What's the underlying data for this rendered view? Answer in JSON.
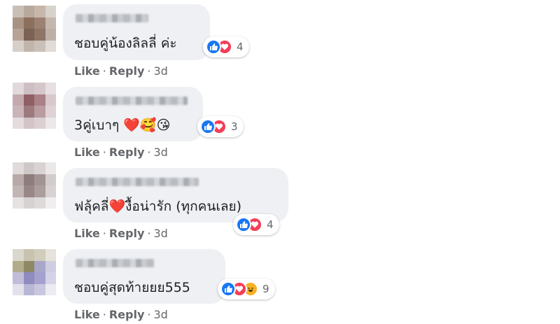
{
  "comments": [
    {
      "text": "ชอบคู่น้องลิลลี่ ค่ะ",
      "reaction_count": "4",
      "reactions": [
        "like-icon",
        "love-icon"
      ],
      "actions": {
        "like": "Like",
        "reply": "Reply",
        "time": "3d"
      }
    },
    {
      "text": "3คู่เบาๆ ❤️🥰😘",
      "reaction_count": "3",
      "reactions": [
        "like-icon",
        "love-icon"
      ],
      "actions": {
        "like": "Like",
        "reply": "Reply",
        "time": "3d"
      }
    },
    {
      "text": "ฟลุ้คลี่❤️งื้อน่ารัก (ทุกคนเลย)",
      "reaction_count": "4",
      "reactions": [
        "like-icon",
        "love-icon"
      ],
      "actions": {
        "like": "Like",
        "reply": "Reply",
        "time": "3d"
      }
    },
    {
      "text": "ชอบคู่สุดท้ายยย555",
      "reaction_count": "9",
      "reactions": [
        "like-icon",
        "love-icon",
        "haha-icon"
      ],
      "actions": {
        "like": "Like",
        "reply": "Reply",
        "time": "3d"
      }
    }
  ],
  "colors": {
    "bubble": "#eef0f3",
    "like": "#1877f2",
    "love": "#f33e58",
    "haha": "#f7b125",
    "meta": "#65676b"
  }
}
